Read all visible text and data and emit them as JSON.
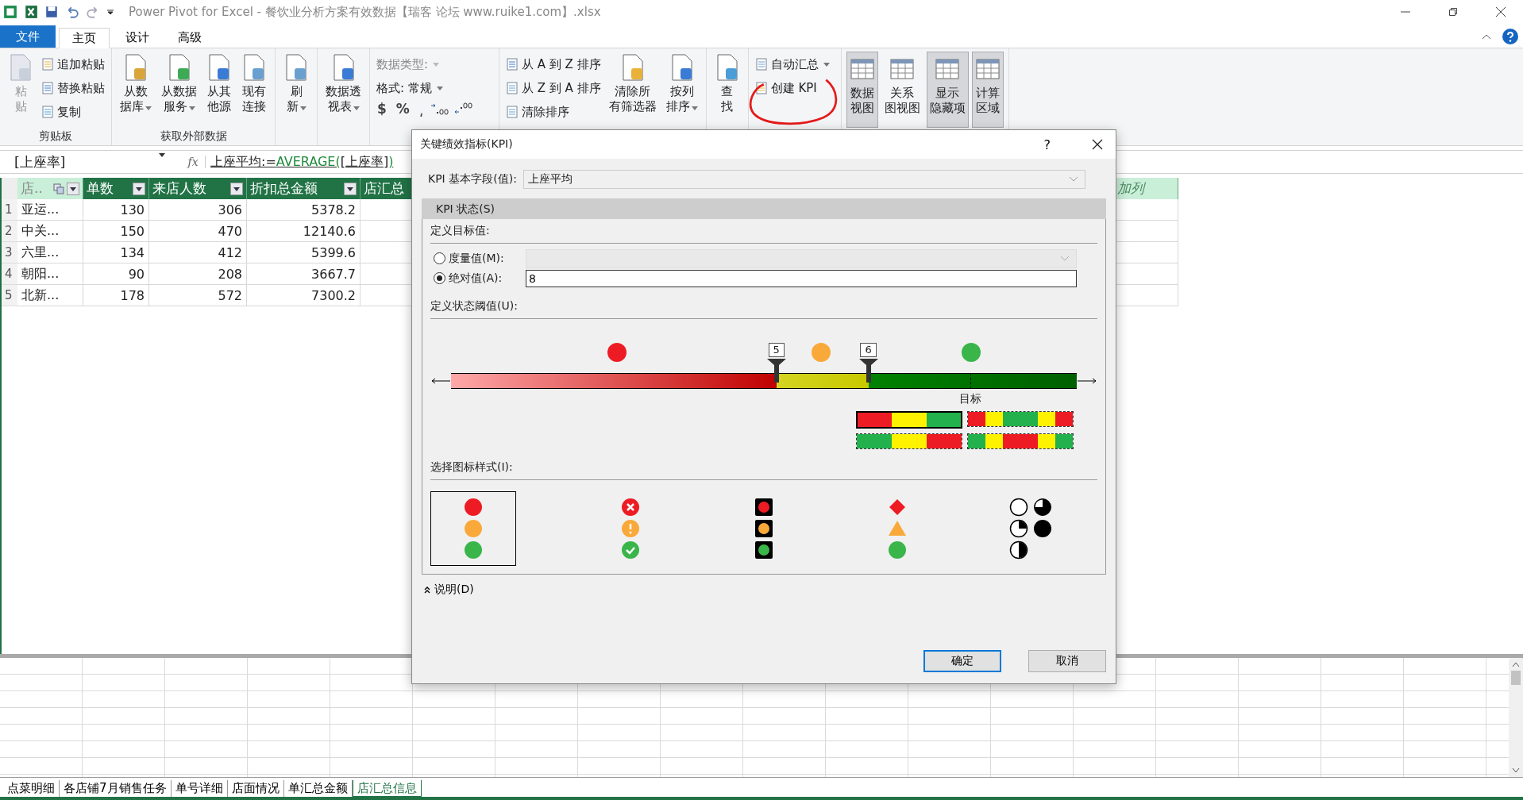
{
  "window": {
    "title": "Power Pivot for Excel - 餐饮业分析方案有效数据【瑞客 论坛 www.ruike1.com】.xlsx"
  },
  "ribbon_tabs": [
    {
      "label": "文件",
      "kind": "file",
      "selected": false
    },
    {
      "label": "主页",
      "kind": "tab",
      "selected": true
    },
    {
      "label": "设计",
      "kind": "tab",
      "selected": false
    },
    {
      "label": "高级",
      "kind": "tab",
      "selected": false
    }
  ],
  "ribbon": [
    {
      "label": "剪贴板",
      "items": [
        {
          "kind": "large",
          "lines": [
            "粘",
            "贴"
          ],
          "disabled": true,
          "dropdown": false
        },
        {
          "kind": "stack",
          "buttons": [
            {
              "label": "追加粘贴",
              "disabled": false,
              "dropdown": false
            },
            {
              "label": "替换粘贴",
              "disabled": false,
              "dropdown": false
            },
            {
              "label": "复制",
              "disabled": false,
              "dropdown": false
            }
          ]
        }
      ]
    },
    {
      "label": "获取外部数据",
      "items": [
        {
          "kind": "large",
          "lines": [
            "从数",
            "据库"
          ],
          "disabled": false,
          "dropdown": true
        },
        {
          "kind": "large",
          "lines": [
            "从数据",
            "服务"
          ],
          "disabled": false,
          "dropdown": true
        },
        {
          "kind": "large",
          "lines": [
            "从其",
            "他源"
          ],
          "disabled": false,
          "dropdown": false
        },
        {
          "kind": "large",
          "lines": [
            "现有",
            "连接"
          ],
          "disabled": false,
          "dropdown": false
        }
      ]
    },
    {
      "items": [
        {
          "kind": "large",
          "lines": [
            "刷",
            "新"
          ],
          "disabled": false,
          "dropdown": true
        }
      ]
    },
    {
      "items": [
        {
          "kind": "large",
          "lines": [
            "数据透",
            "视表"
          ],
          "disabled": false,
          "dropdown": true
        }
      ]
    },
    {
      "items": [
        {
          "kind": "format",
          "type_label": "数据类型:",
          "format_label": "格式: 常规",
          "symbols": [
            "$",
            "%",
            "͵"
          ]
        }
      ]
    },
    {
      "items": [
        {
          "kind": "stack",
          "buttons": [
            {
              "label": "从 A 到 Z 排序",
              "disabled": false,
              "dropdown": false
            },
            {
              "label": "从 Z 到 A 排序",
              "disabled": false,
              "dropdown": false
            },
            {
              "label": "清除排序",
              "disabled": false,
              "dropdown": false
            }
          ]
        },
        {
          "kind": "large",
          "lines": [
            "清除所",
            "有筛选器"
          ],
          "disabled": false,
          "dropdown": false
        },
        {
          "kind": "large",
          "lines": [
            "按列",
            "排序"
          ],
          "disabled": false,
          "dropdown": true
        }
      ]
    },
    {
      "items": [
        {
          "kind": "large",
          "lines": [
            "查",
            "找"
          ],
          "disabled": false,
          "dropdown": false
        }
      ]
    },
    {
      "items": [
        {
          "kind": "stack",
          "buttons": [
            {
              "label": "自动汇总",
              "disabled": false,
              "dropdown": true
            },
            {
              "label": "创建 KPI",
              "disabled": false,
              "dropdown": false
            }
          ]
        }
      ]
    },
    {
      "items": [
        {
          "kind": "toggle",
          "lines": [
            "数据",
            "视图"
          ],
          "selected": true
        },
        {
          "kind": "toggle",
          "lines": [
            "关系",
            "图视图"
          ],
          "selected": false
        },
        {
          "kind": "toggle",
          "lines": [
            "显示",
            "隐藏项"
          ],
          "selected": true
        },
        {
          "kind": "toggle",
          "lines": [
            "计算",
            "区域"
          ],
          "selected": true
        }
      ]
    }
  ],
  "formula_bar": {
    "name_box": "[上座率]",
    "fx": "fx",
    "formula": [
      {
        "text": "上座平均:=",
        "kind": "plain"
      },
      {
        "text": "AVERAGE(",
        "kind": "function"
      },
      {
        "text": "[上座率]",
        "kind": "plain"
      },
      {
        "text": ")",
        "kind": "function"
      }
    ]
  },
  "table": {
    "columns": [
      {
        "label": "店..",
        "selected": true,
        "filter": true
      },
      {
        "label": "单数",
        "selected": false,
        "filter": true
      },
      {
        "label": "来店人数",
        "selected": false,
        "filter": true
      },
      {
        "label": "折扣总金额",
        "selected": false,
        "filter": true
      },
      {
        "label": "店汇总",
        "selected": false
      }
    ],
    "rows": [
      {
        "num": "1",
        "cells": [
          "亚运...",
          "130",
          "306",
          "5378.2"
        ]
      },
      {
        "num": "2",
        "cells": [
          "中关...",
          "150",
          "470",
          "12140.6"
        ]
      },
      {
        "num": "3",
        "cells": [
          "六里...",
          "134",
          "412",
          "5399.6"
        ]
      },
      {
        "num": "4",
        "cells": [
          "朝阳...",
          "90",
          "208",
          "3667.7"
        ]
      },
      {
        "num": "5",
        "cells": [
          "北新...",
          "178",
          "572",
          "7300.2"
        ]
      }
    ],
    "add_column": "加列"
  },
  "sheet_tabs": [
    {
      "label": "点菜明细",
      "selected": false
    },
    {
      "label": "各店铺7月销售任务",
      "selected": false
    },
    {
      "label": "单号详细",
      "selected": false
    },
    {
      "label": "店面情况",
      "selected": false
    },
    {
      "label": "单汇总金额",
      "selected": false
    },
    {
      "label": "店汇总信息",
      "selected": true
    }
  ],
  "dialog": {
    "title": "关键绩效指标(KPI)",
    "help": "?",
    "base_field_label": "KPI 基本字段(值):",
    "base_field_value": "上座平均",
    "section": "KPI 状态(S)",
    "target_heading": "定义目标值:",
    "target_options": [
      {
        "label": "度量值(M):",
        "kind": "dropdown",
        "selected": false
      },
      {
        "label": "绝对值(A):",
        "kind": "input",
        "selected": true,
        "value": "8"
      }
    ],
    "threshold_heading": "定义状态阈值(U):",
    "status_icons": [
      {
        "color": "#ed1c24"
      },
      {
        "color": "#f9a93a"
      },
      {
        "color": "#39b54a"
      }
    ],
    "markers": [
      {
        "value": "5",
        "level": 0.52
      },
      {
        "value": "6",
        "level": 0.667
      }
    ],
    "target_label": "目标",
    "bands": [
      {
        "selected": true,
        "segments": [
          {
            "color": "#ed1c24"
          },
          {
            "color": "#fff200"
          },
          {
            "color": "#22b14c"
          }
        ]
      },
      {
        "selected": false,
        "segments": [
          {
            "color": "#ed1c24"
          },
          {
            "color": "#fff200"
          },
          {
            "color": "#22b14c"
          },
          {
            "color": "#22b14c"
          },
          {
            "color": "#fff200"
          },
          {
            "color": "#ed1c24"
          }
        ]
      },
      {
        "selected": false,
        "segments": [
          {
            "color": "#22b14c"
          },
          {
            "color": "#fff200"
          },
          {
            "color": "#ed1c24"
          }
        ]
      },
      {
        "selected": false,
        "segments": [
          {
            "color": "#22b14c"
          },
          {
            "color": "#fff200"
          },
          {
            "color": "#ed1c24"
          },
          {
            "color": "#ed1c24"
          },
          {
            "color": "#fff200"
          },
          {
            "color": "#22b14c"
          }
        ]
      }
    ],
    "icon_style_heading": "选择图标样式(I):",
    "icon_styles": [
      {
        "selected": true
      },
      {
        "selected": false
      },
      {
        "selected": false
      },
      {
        "selected": false
      },
      {
        "selected": false
      }
    ],
    "description": "说明(D)",
    "ok": "确定",
    "cancel": "取消"
  }
}
